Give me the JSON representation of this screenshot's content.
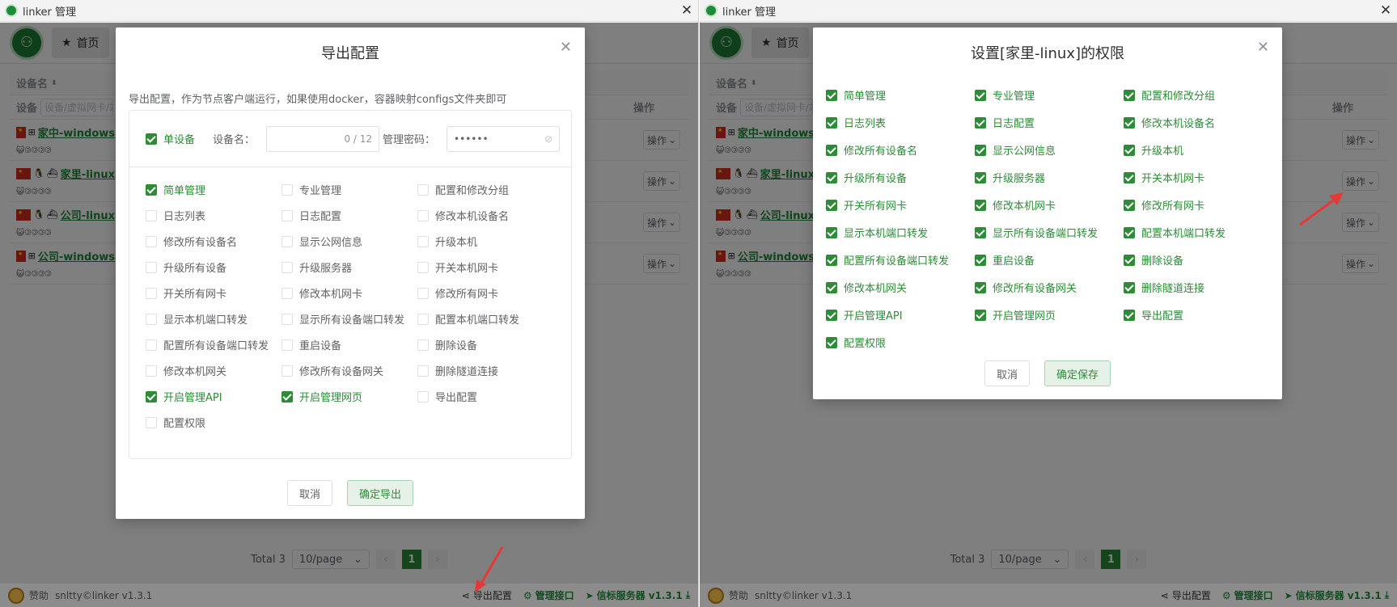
{
  "left_window": {
    "title": "linker 管理",
    "home_label": "首页",
    "table": {
      "col_name": "设备名",
      "col_op": "操作",
      "filter_label": "设备",
      "filter_placeholder": "设备/虚拟网卡/端口",
      "rows": [
        {
          "name": "家中-windows",
          "os": [
            "windows"
          ],
          "op": "操作"
        },
        {
          "name": "家里-linux",
          "os": [
            "linux",
            "docker"
          ],
          "op": "操作"
        },
        {
          "name": "公司-linux",
          "os": [
            "linux",
            "docker"
          ],
          "op": "操作"
        },
        {
          "name": "公司-windows",
          "os": [
            "windows"
          ],
          "op": "操作"
        }
      ]
    },
    "pager": {
      "total": "Total 3",
      "size": "10/page",
      "current": "1"
    },
    "footer": {
      "sponsor": "赞助",
      "copyright": "snltty©linker v1.3.1",
      "export": "导出配置",
      "api": "管理接口",
      "server": "信标服务器",
      "version": "v1.3.1"
    },
    "dialog": {
      "title": "导出配置",
      "desc": "导出配置，作为节点客户端运行，如果使用docker，容器映射configs文件夹即可",
      "single_device": "单设备",
      "device_name_label": "设备名：",
      "device_name_count": "0 / 12",
      "password_label": "管理密码：",
      "password_value": "••••••",
      "permissions": [
        {
          "label": "简单管理",
          "checked": true
        },
        {
          "label": "专业管理",
          "checked": false
        },
        {
          "label": "配置和修改分组",
          "checked": false
        },
        {
          "label": "日志列表",
          "checked": false
        },
        {
          "label": "日志配置",
          "checked": false
        },
        {
          "label": "修改本机设备名",
          "checked": false
        },
        {
          "label": "修改所有设备名",
          "checked": false
        },
        {
          "label": "显示公网信息",
          "checked": false
        },
        {
          "label": "升级本机",
          "checked": false
        },
        {
          "label": "升级所有设备",
          "checked": false
        },
        {
          "label": "升级服务器",
          "checked": false
        },
        {
          "label": "开关本机网卡",
          "checked": false
        },
        {
          "label": "开关所有网卡",
          "checked": false
        },
        {
          "label": "修改本机网卡",
          "checked": false
        },
        {
          "label": "修改所有网卡",
          "checked": false
        },
        {
          "label": "显示本机端口转发",
          "checked": false
        },
        {
          "label": "显示所有设备端口转发",
          "checked": false
        },
        {
          "label": "配置本机端口转发",
          "checked": false
        },
        {
          "label": "配置所有设备端口转发",
          "checked": false
        },
        {
          "label": "重启设备",
          "checked": false
        },
        {
          "label": "删除设备",
          "checked": false
        },
        {
          "label": "修改本机网关",
          "checked": false
        },
        {
          "label": "修改所有设备网关",
          "checked": false
        },
        {
          "label": "删除隧道连接",
          "checked": false
        },
        {
          "label": "开启管理API",
          "checked": true
        },
        {
          "label": "开启管理网页",
          "checked": true
        },
        {
          "label": "导出配置",
          "checked": false
        },
        {
          "label": "配置权限",
          "checked": false
        }
      ],
      "cancel": "取消",
      "confirm": "确定导出"
    }
  },
  "right_window": {
    "title": "linker 管理",
    "home_label": "首页",
    "table": {
      "col_name": "设备名",
      "col_op": "操作",
      "filter_label": "设备",
      "filter_placeholder": "设备/虚拟网卡/端口",
      "rows": [
        {
          "name": "家中-windows",
          "os": [
            "windows"
          ],
          "op": "操作"
        },
        {
          "name": "家里-linux",
          "os": [
            "linux",
            "docker"
          ],
          "op": "操作"
        },
        {
          "name": "公司-linux",
          "os": [
            "linux",
            "docker"
          ],
          "op": "操作"
        },
        {
          "name": "公司-windows",
          "os": [
            "windows"
          ],
          "op": "操作"
        }
      ]
    },
    "pager": {
      "total": "Total 3",
      "size": "10/page",
      "current": "1"
    },
    "footer": {
      "sponsor": "赞助",
      "copyright": "snltty©linker v1.3.1",
      "export": "导出配置",
      "api": "管理接口",
      "server": "信标服务器",
      "version": "v1.3.1"
    },
    "dialog": {
      "title": "设置[家里-linux]的权限",
      "permissions": [
        "简单管理",
        "专业管理",
        "配置和修改分组",
        "日志列表",
        "日志配置",
        "修改本机设备名",
        "修改所有设备名",
        "显示公网信息",
        "升级本机",
        "升级所有设备",
        "升级服务器",
        "开关本机网卡",
        "开关所有网卡",
        "修改本机网卡",
        "修改所有网卡",
        "显示本机端口转发",
        "显示所有设备端口转发",
        "配置本机端口转发",
        "配置所有设备端口转发",
        "重启设备",
        "删除设备",
        "修改本机网关",
        "修改所有设备网关",
        "删除隧道连接",
        "开启管理API",
        "开启管理网页",
        "导出配置",
        "配置权限"
      ],
      "cancel": "取消",
      "confirm": "确定保存"
    }
  },
  "colors": {
    "accent": "#2e8b37",
    "arrow": "#e53935"
  }
}
